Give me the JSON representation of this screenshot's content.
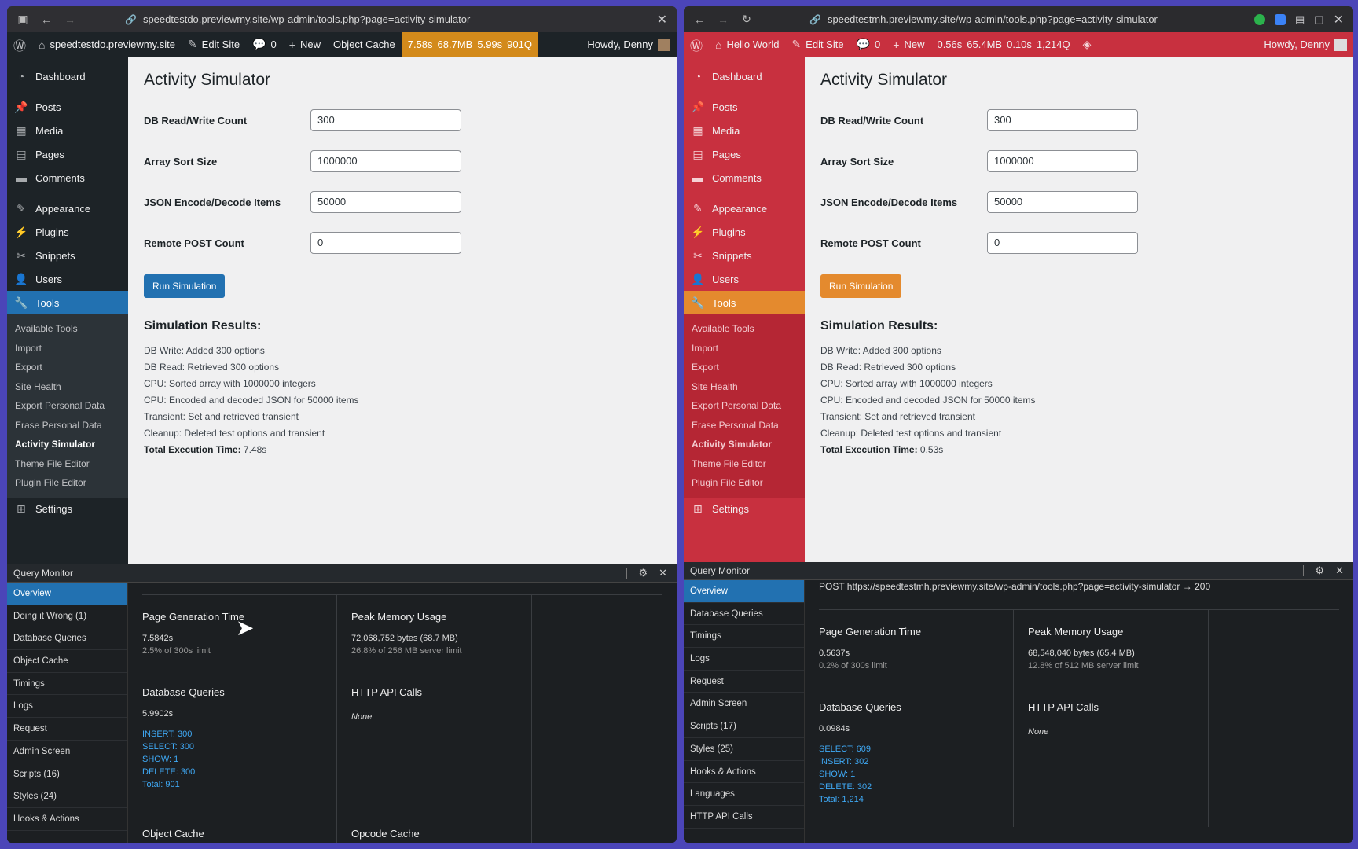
{
  "left": {
    "url": "speedtestdo.previewmy.site/wp-admin/tools.php?page=activity-simulator",
    "adminbar": {
      "site": "speedtestdo.previewmy.site",
      "edit": "Edit Site",
      "comments": "0",
      "new": "New",
      "extra": "Object Cache",
      "perf": [
        "7.58s",
        "68.7MB",
        "5.99s",
        "901Q"
      ],
      "howdy": "Howdy, Denny"
    },
    "menu": {
      "dashboard": "Dashboard",
      "posts": "Posts",
      "media": "Media",
      "pages": "Pages",
      "comments": "Comments",
      "appearance": "Appearance",
      "plugins": "Plugins",
      "snippets": "Snippets",
      "users": "Users",
      "tools": "Tools",
      "settings": "Settings",
      "sub": [
        "Available Tools",
        "Import",
        "Export",
        "Site Health",
        "Export Personal Data",
        "Erase Personal Data",
        "Activity Simulator",
        "Theme File Editor",
        "Plugin File Editor"
      ]
    },
    "page": {
      "title": "Activity Simulator",
      "fields": [
        {
          "label": "DB Read/Write Count",
          "value": "300"
        },
        {
          "label": "Array Sort Size",
          "value": "1000000"
        },
        {
          "label": "JSON Encode/Decode Items",
          "value": "50000"
        },
        {
          "label": "Remote POST Count",
          "value": "0"
        }
      ],
      "button": "Run Simulation",
      "results_title": "Simulation Results:",
      "results": [
        "DB Write: Added 300 options",
        "DB Read: Retrieved 300 options",
        "CPU: Sorted array with 1000000 integers",
        "CPU: Encoded and decoded JSON for 50000 items",
        "Transient: Set and retrieved transient",
        "Cleanup: Deleted test options and transient"
      ],
      "total_label": "Total Execution Time:",
      "total_value": "7.48s"
    },
    "qm": {
      "title": "Query Monitor",
      "nav": [
        "Overview",
        "Doing it Wrong (1)",
        "Database Queries",
        "Object Cache",
        "Timings",
        "Logs",
        "Request",
        "Admin Screen",
        "Scripts (16)",
        "Styles (24)",
        "Hooks & Actions"
      ],
      "pgt_title": "Page Generation Time",
      "pgt_value": "7.5842s",
      "pgt_sub": "2.5% of 300s limit",
      "mem_title": "Peak Memory Usage",
      "mem_value": "72,068,752 bytes (68.7 MB)",
      "mem_sub": "26.8% of 256 MB server limit",
      "db_title": "Database Queries",
      "db_value": "5.9902s",
      "db_q": [
        "INSERT: 300",
        "SELECT: 300",
        "SHOW: 1",
        "DELETE: 300",
        "Total: 901"
      ],
      "http_title": "HTTP API Calls",
      "http_value": "None",
      "oc_title": "Object Cache",
      "op_title": "Opcode Cache"
    }
  },
  "right": {
    "url": "speedtestmh.previewmy.site/wp-admin/tools.php?page=activity-simulator",
    "adminbar": {
      "site": "Hello World",
      "edit": "Edit Site",
      "comments": "0",
      "new": "New",
      "perf": [
        "0.56s",
        "65.4MB",
        "0.10s",
        "1,214Q"
      ],
      "howdy": "Howdy, Denny"
    },
    "menu": {
      "dashboard": "Dashboard",
      "posts": "Posts",
      "media": "Media",
      "pages": "Pages",
      "comments": "Comments",
      "appearance": "Appearance",
      "plugins": "Plugins",
      "snippets": "Snippets",
      "users": "Users",
      "tools": "Tools",
      "settings": "Settings",
      "sub": [
        "Available Tools",
        "Import",
        "Export",
        "Site Health",
        "Export Personal Data",
        "Erase Personal Data",
        "Activity Simulator",
        "Theme File Editor",
        "Plugin File Editor"
      ]
    },
    "page": {
      "title": "Activity Simulator",
      "fields": [
        {
          "label": "DB Read/Write Count",
          "value": "300"
        },
        {
          "label": "Array Sort Size",
          "value": "1000000"
        },
        {
          "label": "JSON Encode/Decode Items",
          "value": "50000"
        },
        {
          "label": "Remote POST Count",
          "value": "0"
        }
      ],
      "button": "Run Simulation",
      "results_title": "Simulation Results:",
      "results": [
        "DB Write: Added 300 options",
        "DB Read: Retrieved 300 options",
        "CPU: Sorted array with 1000000 integers",
        "CPU: Encoded and decoded JSON for 50000 items",
        "Transient: Set and retrieved transient",
        "Cleanup: Deleted test options and transient"
      ],
      "total_label": "Total Execution Time:",
      "total_value": "0.53s"
    },
    "qm": {
      "title": "Query Monitor",
      "post": "POST https://speedtestmh.previewmy.site/wp-admin/tools.php?page=activity-simulator → 200",
      "nav": [
        "Overview",
        "Database Queries",
        "Timings",
        "Logs",
        "Request",
        "Admin Screen",
        "Scripts (17)",
        "Styles (25)",
        "Hooks & Actions",
        "Languages",
        "HTTP API Calls"
      ],
      "pgt_title": "Page Generation Time",
      "pgt_value": "0.5637s",
      "pgt_sub": "0.2% of 300s limit",
      "mem_title": "Peak Memory Usage",
      "mem_value": "68,548,040 bytes (65.4 MB)",
      "mem_sub": "12.8% of 512 MB server limit",
      "db_title": "Database Queries",
      "db_value": "0.0984s",
      "db_q": [
        "SELECT: 609",
        "INSERT: 302",
        "SHOW: 1",
        "DELETE: 302",
        "Total: 1,214"
      ],
      "http_title": "HTTP API Calls",
      "http_value": "None"
    }
  }
}
